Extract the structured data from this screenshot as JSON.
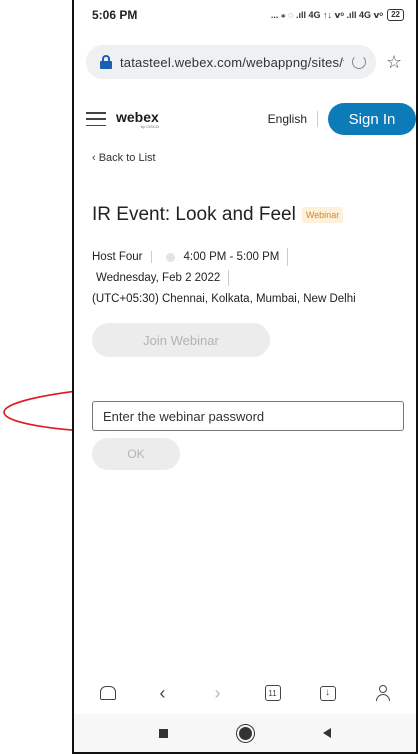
{
  "status_bar": {
    "time": "5:06 PM",
    "signal": "... ⁎ ◌ .ıll 4G ↑↓ ⅴᵒ .ıll 4G ⅴᵒ",
    "battery": "22"
  },
  "browser": {
    "url": "tatasteel.webex.com/webappng/sites/ta"
  },
  "header": {
    "logo": "webex",
    "logo_sub": "by CISCO",
    "language": "English",
    "signin_label": "Sign In"
  },
  "back_link": "‹ Back to List",
  "event": {
    "title": "IR Event: Look and Feel",
    "badge": "Webinar",
    "host": "Host Four",
    "time": "4:00 PM - 5:00 PM",
    "date": "Wednesday, Feb 2 2022",
    "timezone": "(UTC+05:30) Chennai, Kolkata, Mumbai, New Delhi"
  },
  "join_label": "Join Webinar",
  "password": {
    "placeholder": "Enter the webinar password",
    "value": ""
  },
  "ok_label": "OK",
  "toolbar": {
    "back": "‹",
    "forward": "›",
    "tab_count": "11",
    "download": "↓"
  },
  "colors": {
    "accent": "#0d7bb8",
    "badge_text": "#d38a1a",
    "badge_bg": "#fdf1dc",
    "annotation": "#e0191c"
  }
}
